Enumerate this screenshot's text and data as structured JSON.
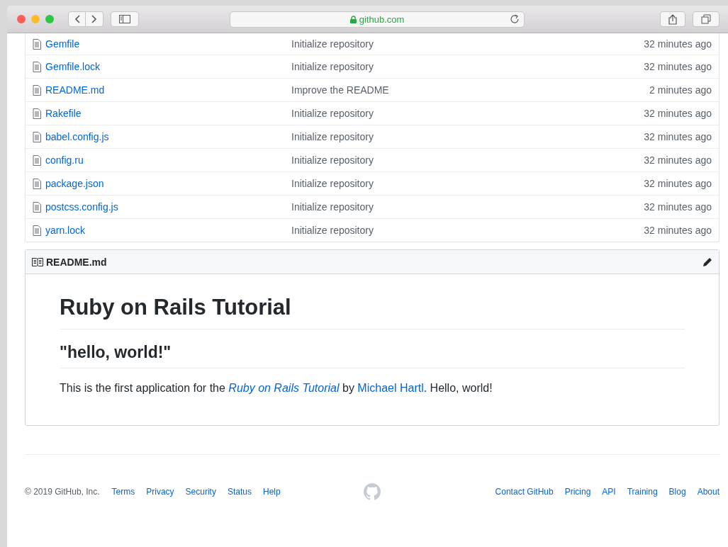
{
  "browser": {
    "url": "github.com"
  },
  "files": [
    {
      "name": "Gemfile",
      "message": "Initialize repository",
      "age": "32 minutes ago"
    },
    {
      "name": "Gemfile.lock",
      "message": "Initialize repository",
      "age": "32 minutes ago"
    },
    {
      "name": "README.md",
      "message": "Improve the README",
      "age": "2 minutes ago"
    },
    {
      "name": "Rakefile",
      "message": "Initialize repository",
      "age": "32 minutes ago"
    },
    {
      "name": "babel.config.js",
      "message": "Initialize repository",
      "age": "32 minutes ago"
    },
    {
      "name": "config.ru",
      "message": "Initialize repository",
      "age": "32 minutes ago"
    },
    {
      "name": "package.json",
      "message": "Initialize repository",
      "age": "32 minutes ago"
    },
    {
      "name": "postcss.config.js",
      "message": "Initialize repository",
      "age": "32 minutes ago"
    },
    {
      "name": "yarn.lock",
      "message": "Initialize repository",
      "age": "32 minutes ago"
    }
  ],
  "readme": {
    "filename": "README.md",
    "title": "Ruby on Rails Tutorial",
    "subtitle": "\"hello, world!\"",
    "paragraph": [
      {
        "kind": "text",
        "text": "This is the first application for the "
      },
      {
        "kind": "link",
        "text": "Ruby on Rails Tutorial",
        "italic": true
      },
      {
        "kind": "text",
        "text": " by "
      },
      {
        "kind": "link",
        "text": "Michael Hartl",
        "italic": false
      },
      {
        "kind": "text",
        "text": ". Hello, world!"
      }
    ]
  },
  "footer": {
    "copyright": "© 2019 GitHub, Inc.",
    "left_links": [
      "Terms",
      "Privacy",
      "Security",
      "Status",
      "Help"
    ],
    "right_links": [
      "Contact GitHub",
      "Pricing",
      "API",
      "Training",
      "Blog",
      "About"
    ]
  }
}
